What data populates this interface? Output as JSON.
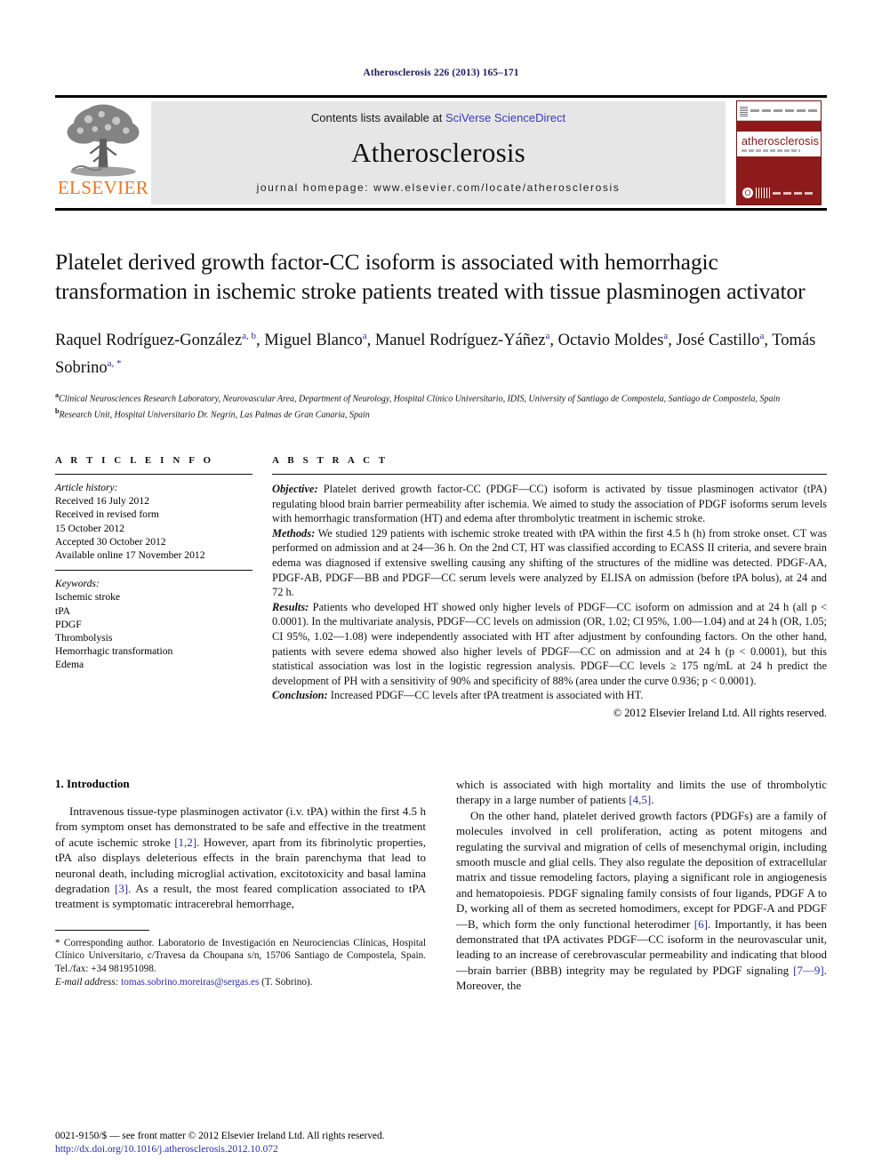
{
  "running_head": "Atherosclerosis 226 (2013) 165–171",
  "banner": {
    "publisher_wordmark": "ELSEVIER",
    "contents_prefix": "Contents lists available at ",
    "contents_link": "SciVerse ScienceDirect",
    "journal_name": "Atherosclerosis",
    "homepage_line": "journal homepage: www.elsevier.com/locate/atherosclerosis",
    "cover_title": "atherosclerosis",
    "accent_orange": "#E87722",
    "accent_link": "#3b3bbb",
    "cover_red": "#8e1b1b",
    "band_gray": "#e6e6e6"
  },
  "article": {
    "title": "Platelet derived growth factor-CC isoform is associated with hemorrhagic transformation in ischemic stroke patients treated with tissue plasminogen activator",
    "authors": [
      {
        "name": "Raquel Rodríguez-González",
        "marks": "a, b",
        "sep": ", "
      },
      {
        "name": "Miguel Blanco",
        "marks": "a",
        "sep": ", "
      },
      {
        "name": "Manuel Rodríguez-Yáñez",
        "marks": "a",
        "sep": ", "
      },
      {
        "name": "Octavio Moldes",
        "marks": "a",
        "sep": ", "
      },
      {
        "name": "José Castillo",
        "marks": "a",
        "sep": ", "
      },
      {
        "name": "Tomás Sobrino",
        "marks": "a, *",
        "sep": ""
      }
    ],
    "affiliations": [
      {
        "mark": "a",
        "text": "Clinical Neurosciences Research Laboratory, Neurovascular Area, Department of Neurology, Hospital Clínico Universitario, IDIS, University of Santiago de Compostela, Santiago de Compostela, Spain"
      },
      {
        "mark": "b",
        "text": "Research Unit, Hospital Universitario Dr. Negrín, Las Palmas de Gran Canaria, Spain"
      }
    ]
  },
  "article_info": {
    "heading": "A R T I C L E   I N F O",
    "history_label": "Article history:",
    "history": [
      "Received 16 July 2012",
      "Received in revised form",
      "15 October 2012",
      "Accepted 30 October 2012",
      "Available online 17 November 2012"
    ],
    "keywords_label": "Keywords:",
    "keywords": [
      "Ischemic stroke",
      "tPA",
      "PDGF",
      "Thrombolysis",
      "Hemorrhagic transformation",
      "Edema"
    ]
  },
  "abstract": {
    "heading": "A B S T R A C T",
    "sections": [
      {
        "label": "Objective:",
        "text": " Platelet derived growth factor-CC (PDGF—CC) isoform is activated by tissue plasminogen activator (tPA) regulating blood brain barrier permeability after ischemia. We aimed to study the association of PDGF isoforms serum levels with hemorrhagic transformation (HT) and edema after thrombolytic treatment in ischemic stroke."
      },
      {
        "label": "Methods:",
        "text": " We studied 129 patients with ischemic stroke treated with tPA within the first 4.5 h (h) from stroke onset. CT was performed on admission and at 24—36 h. On the 2nd CT, HT was classified according to ECASS II criteria, and severe brain edema was diagnosed if extensive swelling causing any shifting of the structures of the midline was detected. PDGF-AA, PDGF-AB, PDGF—BB and PDGF—CC serum levels were analyzed by ELISA on admission (before tPA bolus), at 24 and 72 h."
      },
      {
        "label": "Results:",
        "text": " Patients who developed HT showed only higher levels of PDGF—CC isoform on admission and at 24 h (all p < 0.0001). In the multivariate analysis, PDGF—CC levels on admission (OR, 1.02; CI 95%, 1.00—1.04) and at 24 h (OR, 1.05; CI 95%, 1.02—1.08) were independently associated with HT after adjustment by confounding factors. On the other hand, patients with severe edema showed also higher levels of PDGF—CC on admission and at 24 h (p < 0.0001), but this statistical association was lost in the logistic regression analysis. PDGF—CC levels ≥ 175 ng/mL at 24 h predict the development of PH with a sensitivity of 90% and specificity of 88% (area under the curve 0.936; p < 0.0001)."
      },
      {
        "label": "Conclusion:",
        "text": " Increased PDGF—CC levels after tPA treatment is associated with HT."
      }
    ],
    "copyright": "© 2012 Elsevier Ireland Ltd. All rights reserved."
  },
  "introduction": {
    "heading": "1. Introduction",
    "left_paragraph": "Intravenous tissue-type plasminogen activator (i.v. tPA) within the first 4.5 h from symptom onset has demonstrated to be safe and effective in the treatment of acute ischemic stroke [1,2]. However, apart from its fibrinolytic properties, tPA also displays deleterious effects in the brain parenchyma that lead to neuronal death, including microglial activation, excitotoxicity and basal lamina degradation [3]. As a result, the most feared complication associated to tPA treatment is symptomatic intracerebral hemorrhage,",
    "right_paragraph_1": "which is associated with high mortality and limits the use of thrombolytic therapy in a large number of patients [4,5].",
    "right_paragraph_2": "On the other hand, platelet derived growth factors (PDGFs) are a family of molecules involved in cell proliferation, acting as potent mitogens and regulating the survival and migration of cells of mesenchymal origin, including smooth muscle and glial cells. They also regulate the deposition of extracellular matrix and tissue remodeling factors, playing a significant role in angiogenesis and hematopoiesis. PDGF signaling family consists of four ligands, PDGF A to D, working all of them as secreted homodimers, except for PDGF-A and PDGF—B, which form the only functional heterodimer [6]. Importantly, it has been demonstrated that tPA activates PDGF—CC isoform in the neurovascular unit, leading to an increase of cerebrovascular permeability and indicating that blood—brain barrier (BBB) integrity may be regulated by PDGF signaling [7—9]. Moreover, the"
  },
  "footnote": {
    "corresponding": "* Corresponding author. Laboratorio de Investigación en Neurociencias Clínicas, Hospital Clínico Universitario, c/Travesa da Choupana s/n, 15706 Santiago de Compostela, Spain. Tel./fax: +34 981951098.",
    "email_label": "E-mail address:",
    "email": "tomas.sobrino.moreiras@sergas.es",
    "email_suffix": " (T. Sobrino)."
  },
  "issn_line": {
    "text": "0021-9150/$ — see front matter © 2012 Elsevier Ireland Ltd. All rights reserved.",
    "doi": "http://dx.doi.org/10.1016/j.atherosclerosis.2012.10.072"
  }
}
